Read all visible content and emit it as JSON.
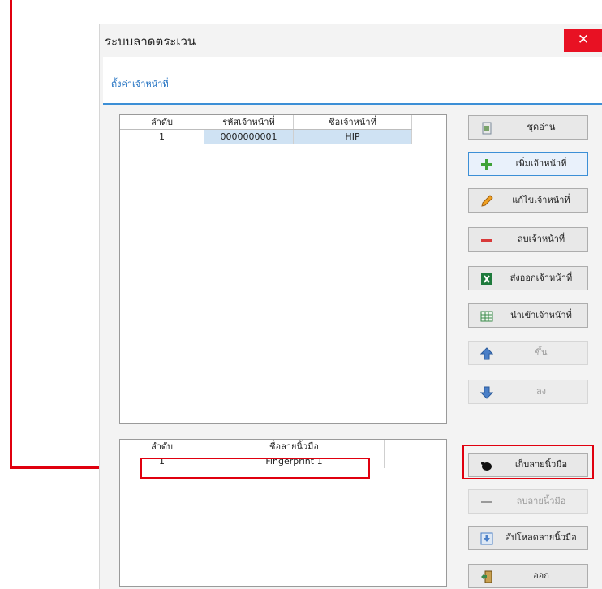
{
  "window": {
    "title": "ระบบลาดตระเวน",
    "close_glyph": "✕"
  },
  "tab": {
    "label": "ตั้งค่าเจ้าหน้าที่"
  },
  "officers_table": {
    "headers": [
      "ลำดับ",
      "รหัสเจ้าหน้าที่",
      "ชื่อเจ้าหน้าที่"
    ],
    "rows": [
      [
        "1",
        "0000000001",
        "HIP"
      ]
    ]
  },
  "fingerprint_table": {
    "headers": [
      "ลำดับ",
      "ชื่อลายนิ้วมือ"
    ],
    "rows": [
      [
        "1",
        "Fingerprint 1"
      ]
    ]
  },
  "buttons": {
    "reader": "ชุดอ่าน",
    "add_officer": "เพิ่มเจ้าหน้าที่",
    "edit_officer": "แก้ไขเจ้าหน้าที่",
    "delete_officer": "ลบเจ้าหน้าที่",
    "export_officer": "ส่งออกเจ้าหน้าที่",
    "import_officer": "นำเข้าเจ้าหน้าที่",
    "move_up": "ขึ้น",
    "move_down": "ลง",
    "capture_fingerprint": "เก็บลายนิ้วมือ",
    "delete_fingerprint": "ลบลายนิ้วมือ",
    "upload_fingerprint": "อัปโหลดลายนิ้วมือ",
    "exit": "ออก"
  },
  "colors": {
    "accent": "#3c8fd6",
    "close": "#e81123",
    "annotation": "#e0000f",
    "selected_row": "#cfe2f3"
  }
}
